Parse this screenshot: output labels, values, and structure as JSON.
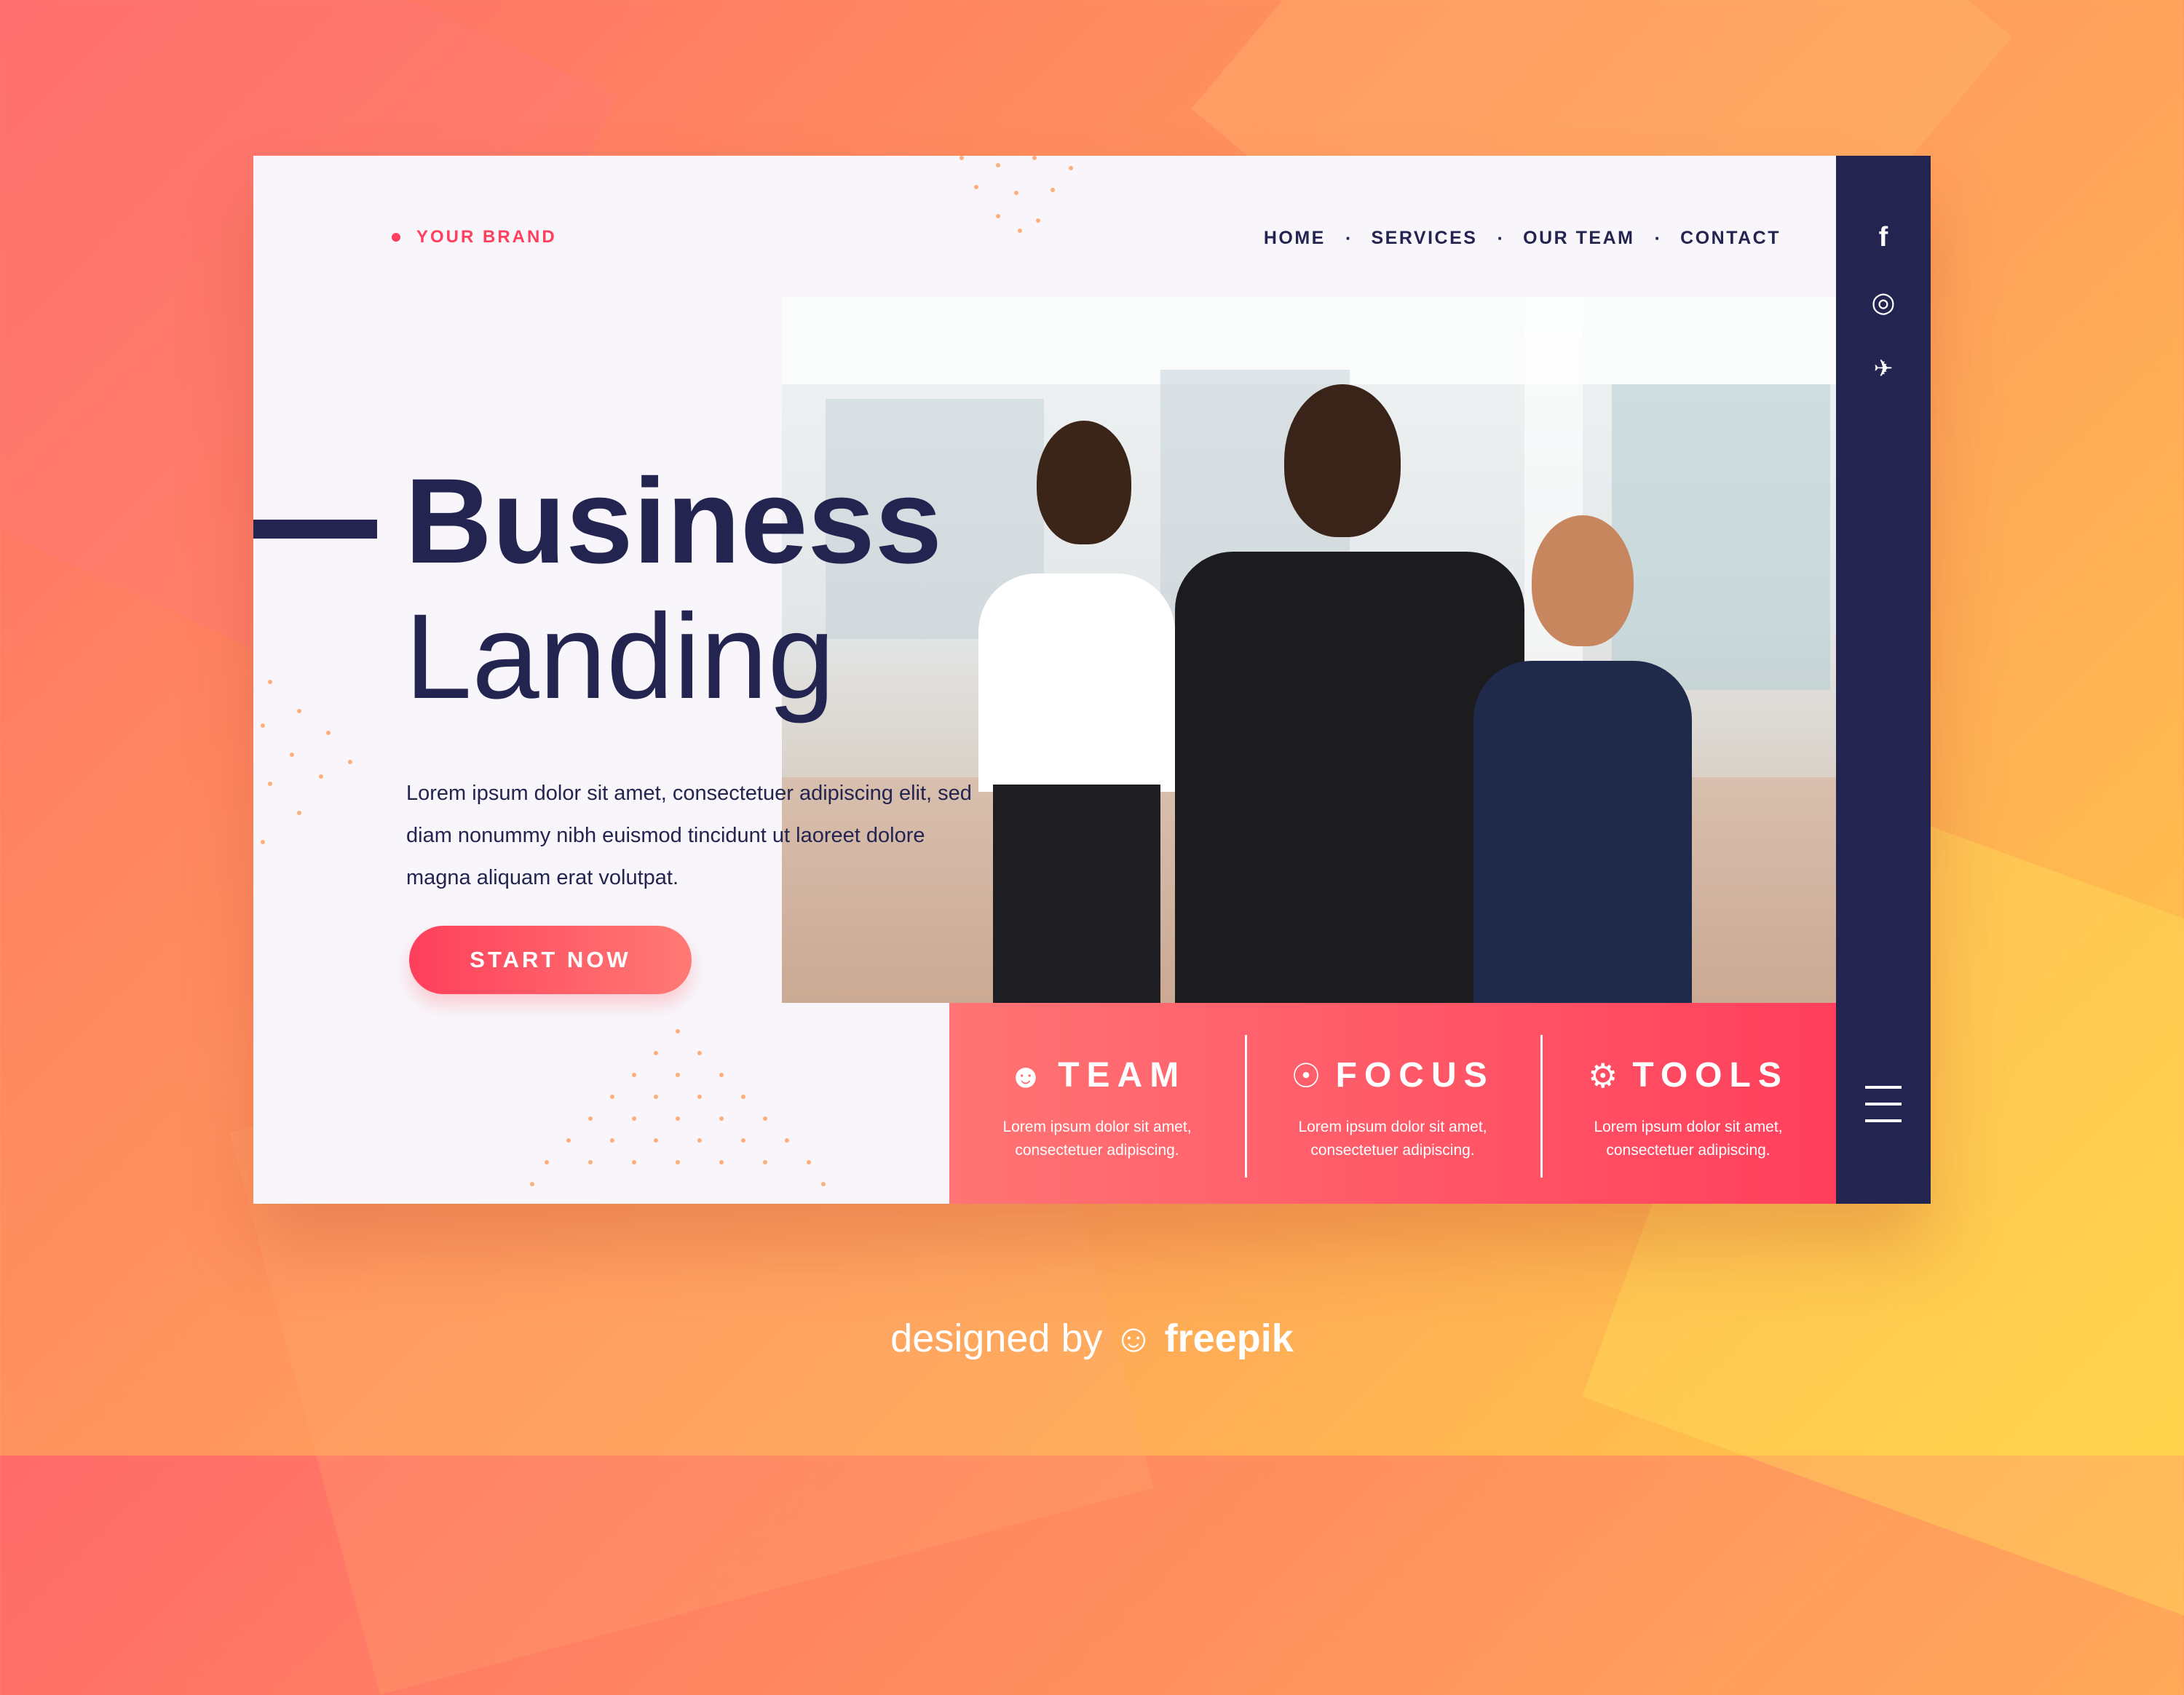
{
  "brand": {
    "name": "YOUR BRAND"
  },
  "nav": {
    "items": [
      "HOME",
      "SERVICES",
      "OUR TEAM",
      "CONTACT"
    ]
  },
  "social": {
    "facebook": "f",
    "instagram": "◎",
    "twitter": "✈"
  },
  "hero": {
    "title_line1": "Business",
    "title_line2": "Landing",
    "description": "Lorem ipsum dolor sit amet, consectetuer adipiscing elit, sed diam nonummy nibh euismod tincidunt ut laoreet dolore magna aliquam erat volutpat.",
    "cta_label": "START NOW"
  },
  "features": [
    {
      "icon": "team-icon",
      "title": "TEAM",
      "text": "Lorem ipsum dolor sit amet, consectetuer adipiscing."
    },
    {
      "icon": "focus-icon",
      "title": "FOCUS",
      "text": "Lorem ipsum dolor sit amet, consectetuer adipiscing."
    },
    {
      "icon": "tools-icon",
      "title": "TOOLS",
      "text": "Lorem ipsum dolor sit amet, consectetuer adipiscing."
    }
  ],
  "footer": {
    "prefix": "designed by",
    "brand": "freepik"
  },
  "colors": {
    "navy": "#232450",
    "accent": "#ff3f5c",
    "accent_light": "#ff7474",
    "card_bg": "#f8f6fb"
  }
}
